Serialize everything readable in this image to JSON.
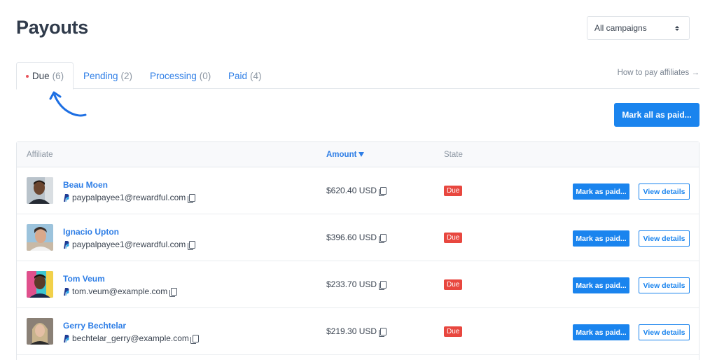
{
  "page": {
    "title": "Payouts"
  },
  "campaign_select": {
    "value": "All campaigns"
  },
  "tabs": [
    {
      "label": "Due",
      "count": "(6)",
      "active": true
    },
    {
      "label": "Pending",
      "count": "(2)"
    },
    {
      "label": "Processing",
      "count": "(0)"
    },
    {
      "label": "Paid",
      "count": "(4)"
    }
  ],
  "help_link": "How to pay affiliates →",
  "mark_all_label": "Mark all as paid...",
  "table": {
    "headers": {
      "affiliate": "Affiliate",
      "amount": "Amount",
      "state": "State"
    },
    "rows": [
      {
        "name": "Beau Moen",
        "email": "paypalpayee1@rewardful.com",
        "amount": "$620.40 USD",
        "state": "Due",
        "mark_label": "Mark as paid...",
        "view_label": "View details"
      },
      {
        "name": "Ignacio Upton",
        "email": "paypalpayee1@rewardful.com",
        "amount": "$396.60 USD",
        "state": "Due",
        "mark_label": "Mark as paid...",
        "view_label": "View details"
      },
      {
        "name": "Tom Veum",
        "email": "tom.veum@example.com",
        "amount": "$233.70 USD",
        "state": "Due",
        "mark_label": "Mark as paid...",
        "view_label": "View details"
      },
      {
        "name": "Gerry Bechtelar",
        "email": "bechtelar_gerry@example.com",
        "amount": "$219.30 USD",
        "state": "Due",
        "mark_label": "Mark as paid...",
        "view_label": "View details"
      }
    ]
  },
  "colors": {
    "accent": "#1a84ee",
    "link": "#2e7ee6",
    "due_badge": "#e8473f",
    "due_dot": "#e9535b"
  },
  "icons": {
    "payment_method": "paypal-icon",
    "copy": "copy-icon",
    "sort": "sort-desc-icon",
    "select": "select-updown-icon"
  }
}
